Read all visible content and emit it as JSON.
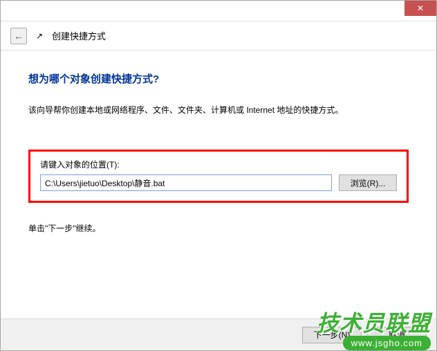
{
  "titlebar": {
    "close_label": "✕"
  },
  "header": {
    "back_icon": "←",
    "shortcut_icon": "↗",
    "title": "创建快捷方式"
  },
  "content": {
    "heading": "想为哪个对象创建快捷方式?",
    "description": "该向导帮你创建本地或网络程序、文件、文件夹、计算机或 Internet 地址的快捷方式。",
    "input_label": "请键入对象的位置(T):",
    "path_value": "C:\\Users\\jietuo\\Desktop\\静音.bat",
    "browse_label": "浏览(R)...",
    "continue_text": "单击\"下一步\"继续。"
  },
  "footer": {
    "next_label": "下一步(N)",
    "cancel_label": "取消"
  },
  "watermark": {
    "brand": "技术员联盟",
    "url": "www.jsgho.com"
  }
}
